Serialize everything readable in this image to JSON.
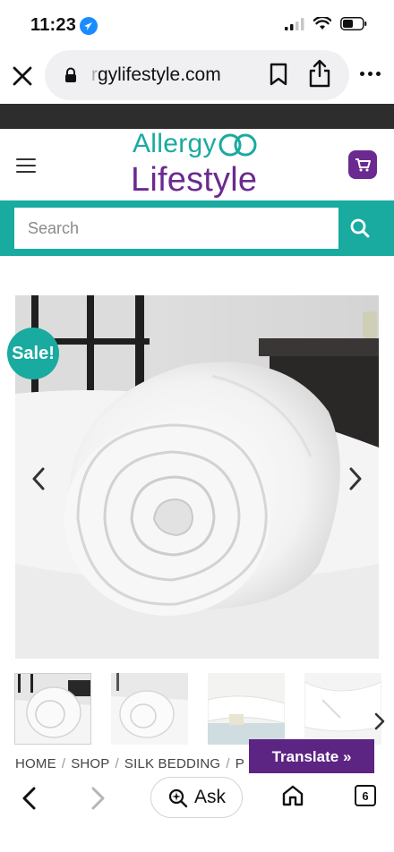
{
  "status_bar": {
    "time": "11:23"
  },
  "browser": {
    "url_faded": "r",
    "url_text": "gylifestyle.com",
    "tabs_count": "6",
    "ask_label": "Ask"
  },
  "site": {
    "logo_top": "Allergy",
    "logo_bottom": "Lifestyle",
    "search_placeholder": "Search",
    "sale_badge": "Sale!"
  },
  "breadcrumb": [
    "HOME",
    "SHOP",
    "SILK BEDDING",
    "P"
  ],
  "translate_label": "Translate »",
  "colors": {
    "teal": "#19aaa0",
    "purple": "#6b2a90",
    "translate_purple": "#5c2483"
  }
}
